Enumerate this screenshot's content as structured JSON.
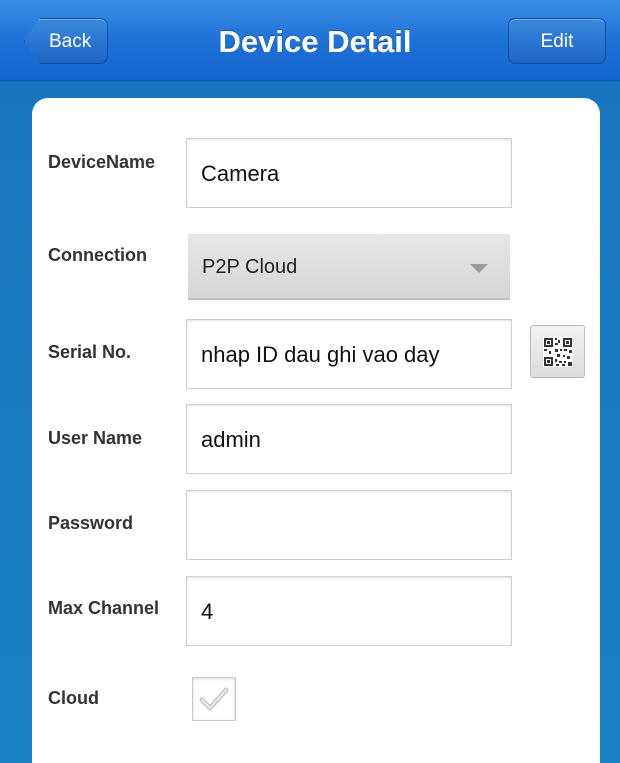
{
  "header": {
    "back_label": "Back",
    "title": "Device Detail",
    "edit_label": "Edit"
  },
  "form": {
    "device_name": {
      "label": "DeviceName",
      "value": "Camera"
    },
    "connection": {
      "label": "Connection",
      "selected": "P2P Cloud"
    },
    "serial_no": {
      "label": "Serial No.",
      "value": "nhap ID dau ghi vao day"
    },
    "user_name": {
      "label": "User Name",
      "value": "admin"
    },
    "password": {
      "label": "Password",
      "value": ""
    },
    "max_channel": {
      "label": "Max Channel",
      "value": "4"
    },
    "cloud": {
      "label": "Cloud",
      "checked": true
    }
  },
  "icons": {
    "back": "back-arrow-shape",
    "qr": "qr-code-icon",
    "dropdown": "chevron-down-icon",
    "check": "check-icon"
  },
  "colors": {
    "header_blue": "#1d6fd6",
    "background_blue": "#1a7cc4",
    "card": "#ffffff"
  }
}
